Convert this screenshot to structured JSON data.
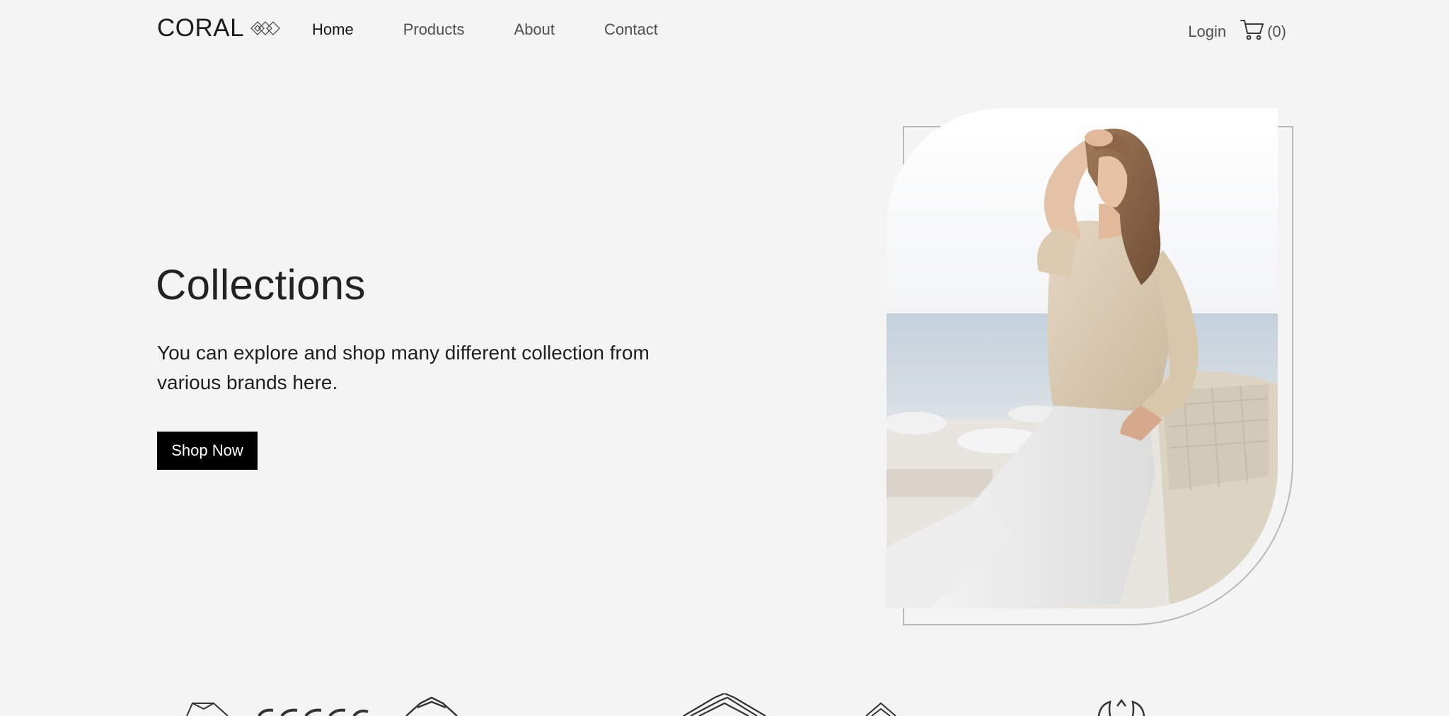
{
  "brand": {
    "name": "CORAL",
    "logo_icon": "diamond-chain-icon"
  },
  "nav": {
    "items": [
      {
        "label": "Home",
        "active": true
      },
      {
        "label": "Products",
        "active": false
      },
      {
        "label": "About",
        "active": false
      },
      {
        "label": "Contact",
        "active": false
      }
    ]
  },
  "header": {
    "login_label": "Login",
    "cart_icon": "cart-icon",
    "cart_count": "(0)"
  },
  "hero": {
    "title": "Collections",
    "description": "You can explore and shop many different collection from various brands here.",
    "cta_label": "Shop Now",
    "image_alt": "woman-in-beige-blouse-and-white-pants-photo"
  },
  "brands_strip": {
    "icons": [
      "brand-logo-1-icon",
      "brand-logo-2-icon",
      "brand-logo-3-icon",
      "brand-logo-4-icon",
      "brand-logo-5-icon",
      "brand-logo-6-icon"
    ]
  },
  "colors": {
    "background": "#f4f4f4",
    "button": "#000000",
    "text": "#1f1f1f",
    "muted_text": "#505050"
  }
}
